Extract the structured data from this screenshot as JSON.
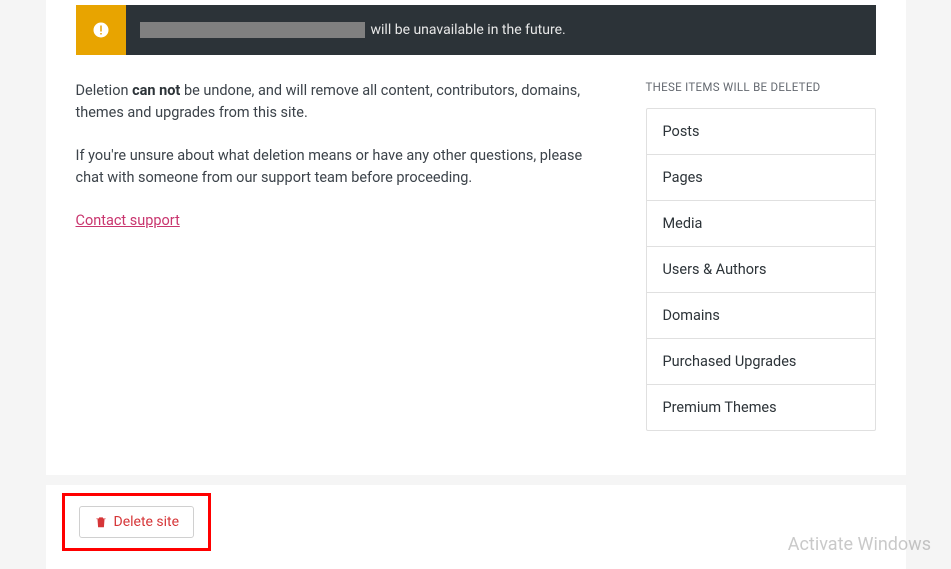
{
  "warning": {
    "suffix_text": "will be unavailable in the future."
  },
  "body": {
    "paragraph1_pre": "Deletion ",
    "paragraph1_strong": "can not",
    "paragraph1_post": " be undone, and will remove all content, contributors, domains, themes and upgrades from this site.",
    "paragraph2": "If you're unsure about what deletion means or have any other questions, please chat with someone from our support team before proceeding.",
    "contact_link": "Contact support"
  },
  "right": {
    "heading": "THESE ITEMS WILL BE DELETED",
    "items": [
      "Posts",
      "Pages",
      "Media",
      "Users & Authors",
      "Domains",
      "Purchased Upgrades",
      "Premium Themes"
    ]
  },
  "footer": {
    "delete_label": "Delete site"
  },
  "watermark": "Activate Windows"
}
